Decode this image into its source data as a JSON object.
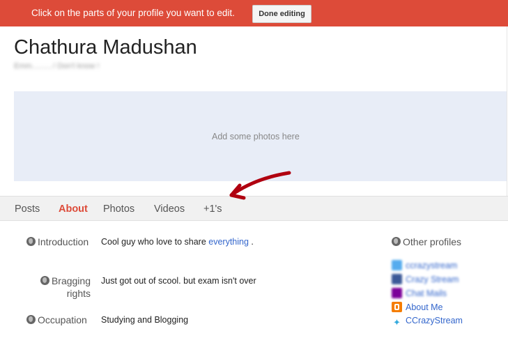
{
  "banner": {
    "message": "Click on the parts of your profile you want to edit.",
    "done_label": "Done editing",
    "color": "#dd4b39"
  },
  "profile": {
    "name": "Chathura Madushan",
    "tagline": "Emm..........! Don't know !"
  },
  "photos": {
    "placeholder": "Add some photos here"
  },
  "tabs": [
    {
      "label": "Posts",
      "active": false
    },
    {
      "label": "About",
      "active": true
    },
    {
      "label": "Photos",
      "active": false
    },
    {
      "label": "Videos",
      "active": false
    },
    {
      "label": "+1's",
      "active": false
    }
  ],
  "about": {
    "introduction": {
      "label": "Introduction",
      "text": "Cool guy who love to share",
      "link": "everything",
      "suffix": " ."
    },
    "bragging": {
      "label_line1": "Bragging",
      "label_line2": "rights",
      "text": "Just got out of scool. but exam isn't over"
    },
    "occupation": {
      "label": "Occupation",
      "text": "Studying and Blogging"
    }
  },
  "other_profiles": {
    "title": "Other profiles",
    "items": [
      {
        "label": "ccrazystream",
        "icon": "twitter-icon"
      },
      {
        "label": "Crazy Stream",
        "icon": "facebook-icon"
      },
      {
        "label": "Chat Mails",
        "icon": "yahoo-icon"
      },
      {
        "label": "About Me",
        "icon": "blogger-icon"
      },
      {
        "label": "CCrazyStream",
        "icon": "twitter-icon"
      }
    ]
  }
}
